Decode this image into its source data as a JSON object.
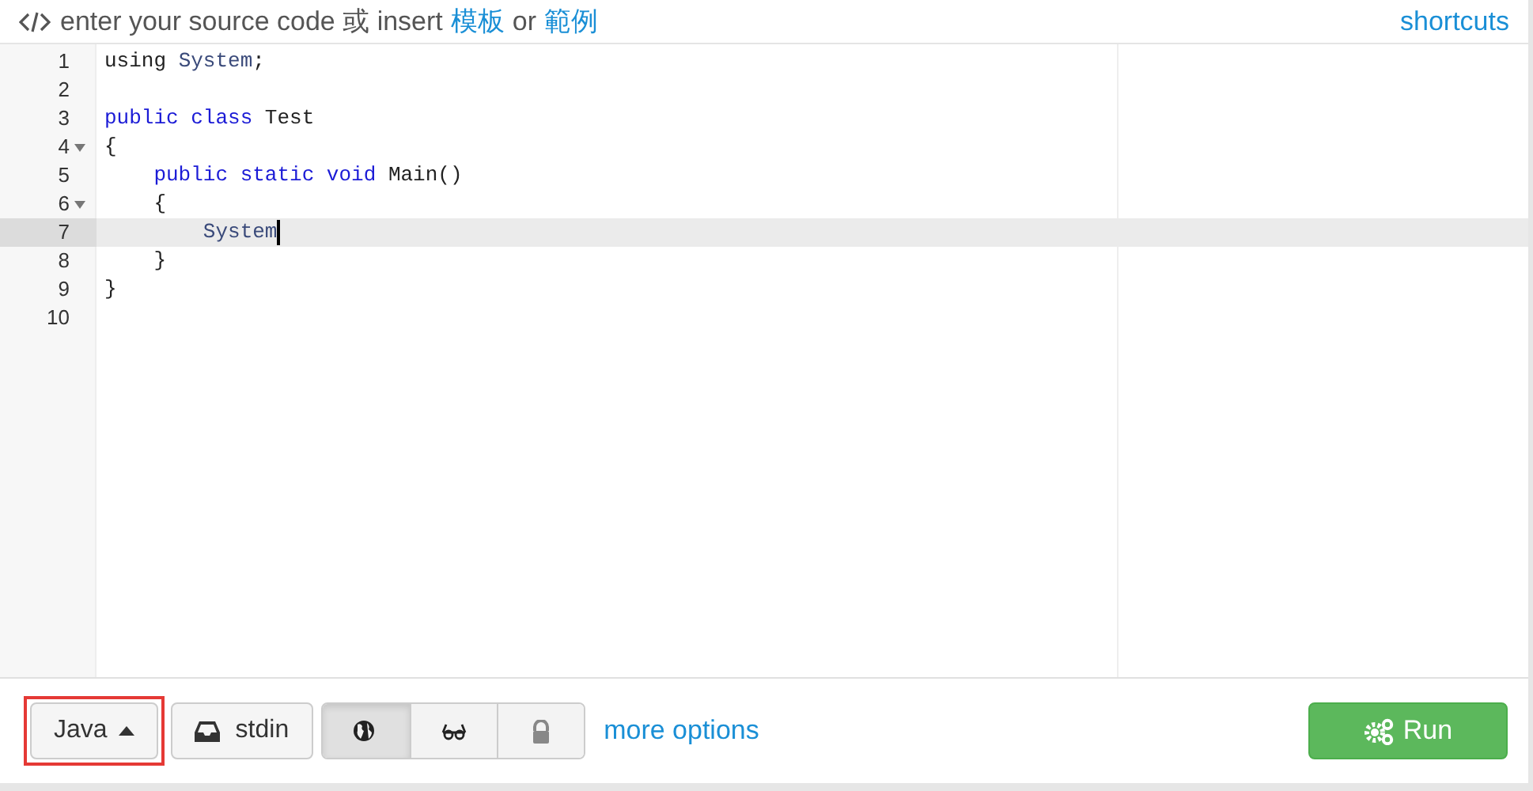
{
  "header": {
    "prompt": "enter your source code 或 insert",
    "links": [
      {
        "label": "模板"
      },
      {
        "label": "範例"
      }
    ],
    "joiner": "or",
    "shortcuts": "shortcuts"
  },
  "editor": {
    "lines": [
      {
        "number": "1",
        "tokens": [
          {
            "kind": "plain",
            "text": "using "
          },
          {
            "kind": "type",
            "text": "System"
          },
          {
            "kind": "plain",
            "text": ";"
          }
        ]
      },
      {
        "number": "2"
      },
      {
        "number": "3",
        "tokens": [
          {
            "kind": "keyword",
            "text": "public class "
          },
          {
            "kind": "plain",
            "text": "Test"
          }
        ]
      },
      {
        "number": "4",
        "foldable": true,
        "tokens": [
          {
            "kind": "plain",
            "text": "{"
          }
        ]
      },
      {
        "number": "5",
        "tokens": [
          {
            "kind": "keyword",
            "text": "    public static void "
          },
          {
            "kind": "plain",
            "text": "Main()"
          }
        ]
      },
      {
        "number": "6",
        "foldable": true,
        "tokens": [
          {
            "kind": "plain",
            "text": "    {"
          }
        ]
      },
      {
        "number": "7",
        "active": true,
        "cursor": true,
        "tokens": [
          {
            "kind": "type",
            "text": "        System"
          }
        ]
      },
      {
        "number": "8",
        "tokens": [
          {
            "kind": "plain",
            "text": "    }"
          }
        ]
      },
      {
        "number": "9",
        "tokens": [
          {
            "kind": "plain",
            "text": "}"
          }
        ]
      },
      {
        "number": "10"
      }
    ]
  },
  "toolbar": {
    "language": {
      "label": "Java",
      "highlighted": true
    },
    "stdin": "stdin",
    "toggles": [
      {
        "kind": "globe",
        "selected": true
      },
      {
        "kind": "glasses",
        "selected": false
      },
      {
        "kind": "lock",
        "selected": false
      }
    ],
    "more_options": "more options",
    "run": "Run"
  }
}
